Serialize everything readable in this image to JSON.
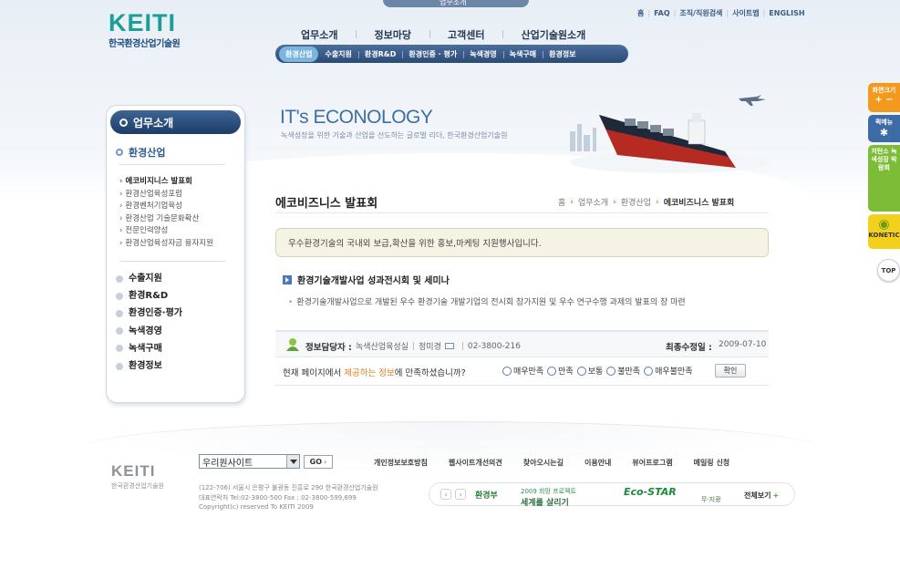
{
  "header": {
    "top_tab_label": "업무소개",
    "logo_mark": "KEITI",
    "logo_sub": "한국환경산업기술원",
    "util_links": [
      "홈",
      "FAQ",
      "조직/직원검색",
      "사이트맵",
      "ENGLISH"
    ],
    "gnb": [
      "업무소개",
      "정보마당",
      "고객센터",
      "산업기술원소개"
    ],
    "subnav": [
      "환경산업",
      "수출지원",
      "환경R&D",
      "환경인증 · 평가",
      "녹색경영",
      "녹색구매",
      "환경정보"
    ],
    "subnav_active_index": 0
  },
  "hero": {
    "title": "IT's ECONOLOGY",
    "subtitle": "녹색성장을 위한 기술과 산업을 선도하는 글로벌 리더, 한국환경산업기술원"
  },
  "sidebar": {
    "heading": "업무소개",
    "current": "환경산업",
    "sub_items": [
      "에코비지니스 발표회",
      "환경산업육성포럼",
      "환경벤처기업육성",
      "환경산업 기술문화확산",
      "전문인력양성",
      "환경산업육성자금 융자지원"
    ],
    "sub_active_index": 0,
    "main_items": [
      "수출지원",
      "환경R&D",
      "환경인증·평가",
      "녹색경영",
      "녹색구매",
      "환경정보"
    ]
  },
  "content": {
    "page_title": "에코비즈니스 발표회",
    "breadcrumb": [
      "홈",
      "업무소개",
      "환경산업",
      "에코비즈니스 발표회"
    ],
    "notice": "우수환경기술의 국내외 보급,확산을 위한 홍보,마케팅 지원행사입니다.",
    "section_title": "환경기술개발사업 성과전시회 및 세미나",
    "section_desc": "환경기술개발사업으로 개발된 우수 환경기술 개발기업의 전시회 참가지원 및 우수 연구수행 과제의 발표의 장 마련",
    "info": {
      "label": "정보담당자 :",
      "department": "녹색산업육성실",
      "name": "정미경",
      "phone": "02-3800-216",
      "date_label": "최종수정일 :",
      "date": "2009-07-10"
    },
    "survey": {
      "question_pre": "현재 페이지에서 ",
      "question_hl": "제공하는 정보",
      "question_post": "에 만족하셨습니까?",
      "options": [
        "매우만족",
        "만족",
        "보통",
        "불만족",
        "매우불만족"
      ],
      "button": "확인"
    }
  },
  "footer": {
    "logo_mark": "KEITI",
    "logo_sub": "한국환경산업기술원",
    "select_value": "우리원사이트",
    "go_label": "GO",
    "links": [
      "개인정보보호방침",
      "웹사이트개선의견",
      "찾아오시는길",
      "이용안내",
      "뷰어프로그램",
      "메일링 신청"
    ],
    "address_lines": [
      "(122-706) 서울시 은평구 불광동 진흥로 290 한국환경산업기술원",
      "대표연락처 Tel:02-3800-500    Fax : 02-3800-599,699",
      "Copyright(c) reserved To KEITI 2009"
    ],
    "banners": {
      "b1": "환경부",
      "b2_small": "2009 희망 프로젝트",
      "b2_big": "세계를 살리기",
      "b3": "Eco-STAR",
      "b4": "무·지광",
      "more": "전체보기"
    }
  },
  "quick_menu": {
    "items": [
      "화면크기",
      "퀵메뉴",
      "저탄소 녹색성장 박람회",
      "KONETIC"
    ],
    "zoom_controls": "+ −",
    "top_label": "TOP"
  },
  "colors": {
    "brand_teal": "#1b9f98",
    "navy": "#1f4d80",
    "accent_orange": "#e07c1e"
  }
}
